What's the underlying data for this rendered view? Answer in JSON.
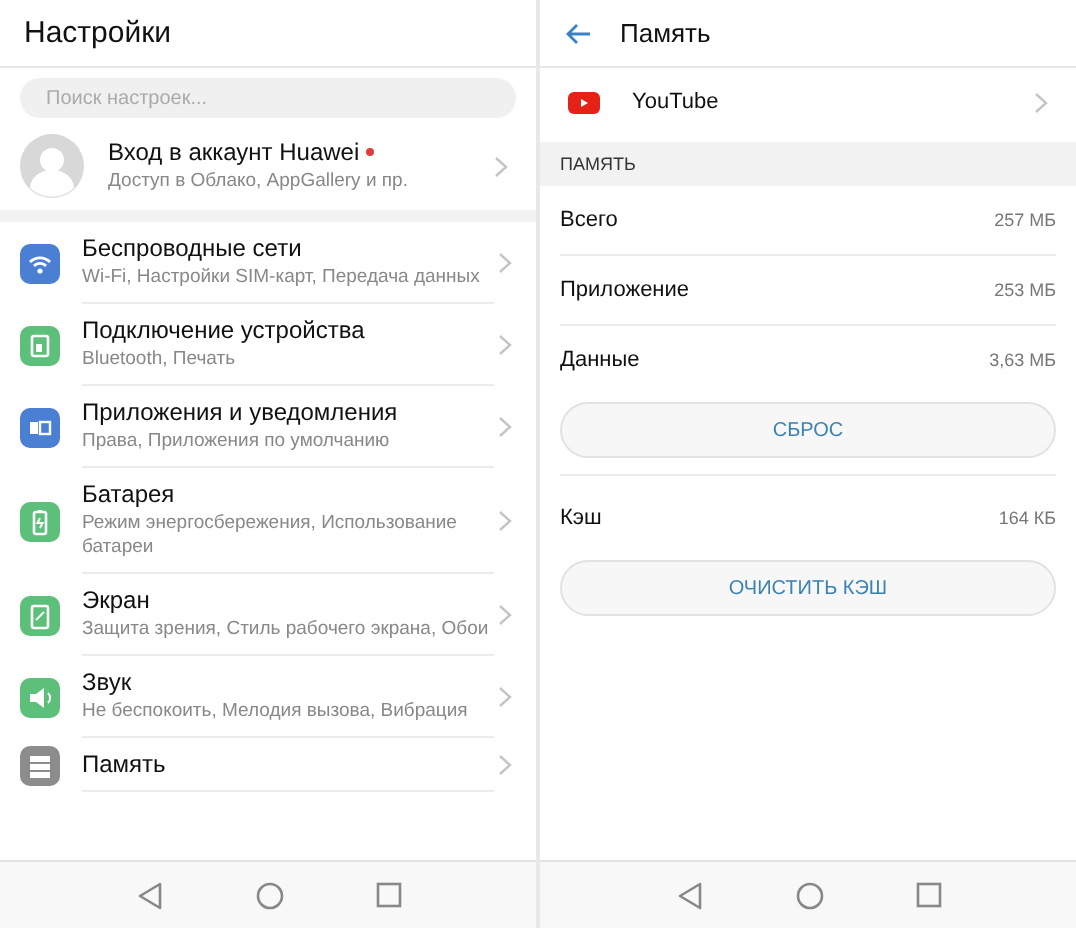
{
  "settings": {
    "title": "Настройки",
    "search": {
      "placeholder": "Поиск настроек..."
    },
    "account": {
      "title": "Вход в аккаунт Huawei",
      "subtitle": "Доступ в Облако, AppGallery и пр.",
      "notification_dot": true
    },
    "items": [
      {
        "title": "Беспроводные сети",
        "subtitle": "Wi-Fi, Настройки SIM-карт, Передача данных",
        "color": "#4a7fd4"
      },
      {
        "title": "Подключение устройства",
        "subtitle": "Bluetooth, Печать",
        "color": "#5cbf7a"
      },
      {
        "title": "Приложения и уведомления",
        "subtitle": "Права, Приложения по умолчанию",
        "color": "#4a7fd4"
      },
      {
        "title": "Батарея",
        "subtitle": "Режим энергосбережения, Использование батареи",
        "color": "#5cbf7a"
      },
      {
        "title": "Экран",
        "subtitle": "Защита зрения, Стиль рабочего экрана, Обои",
        "color": "#5cbf7a"
      },
      {
        "title": "Звук",
        "subtitle": "Не беспокоить, Мелодия вызова, Вибрация",
        "color": "#5cbf7a"
      },
      {
        "title": "Память",
        "color": "#8c8c8c"
      }
    ]
  },
  "storage": {
    "title": "Память",
    "app": {
      "name": "YouTube"
    },
    "section": "ПАМЯТЬ",
    "rows": [
      {
        "kind": "stat",
        "label": "Всего",
        "value": "257 МБ"
      },
      {
        "kind": "stat",
        "label": "Приложение",
        "value": "253 МБ"
      },
      {
        "kind": "stat",
        "label": "Данные",
        "value": "3,63 МБ"
      },
      {
        "kind": "button",
        "label": "СБРОС"
      },
      {
        "kind": "stat",
        "label": "Кэш",
        "value": "164 КБ"
      },
      {
        "kind": "button",
        "label": "ОЧИСТИТЬ КЭШ"
      }
    ]
  }
}
